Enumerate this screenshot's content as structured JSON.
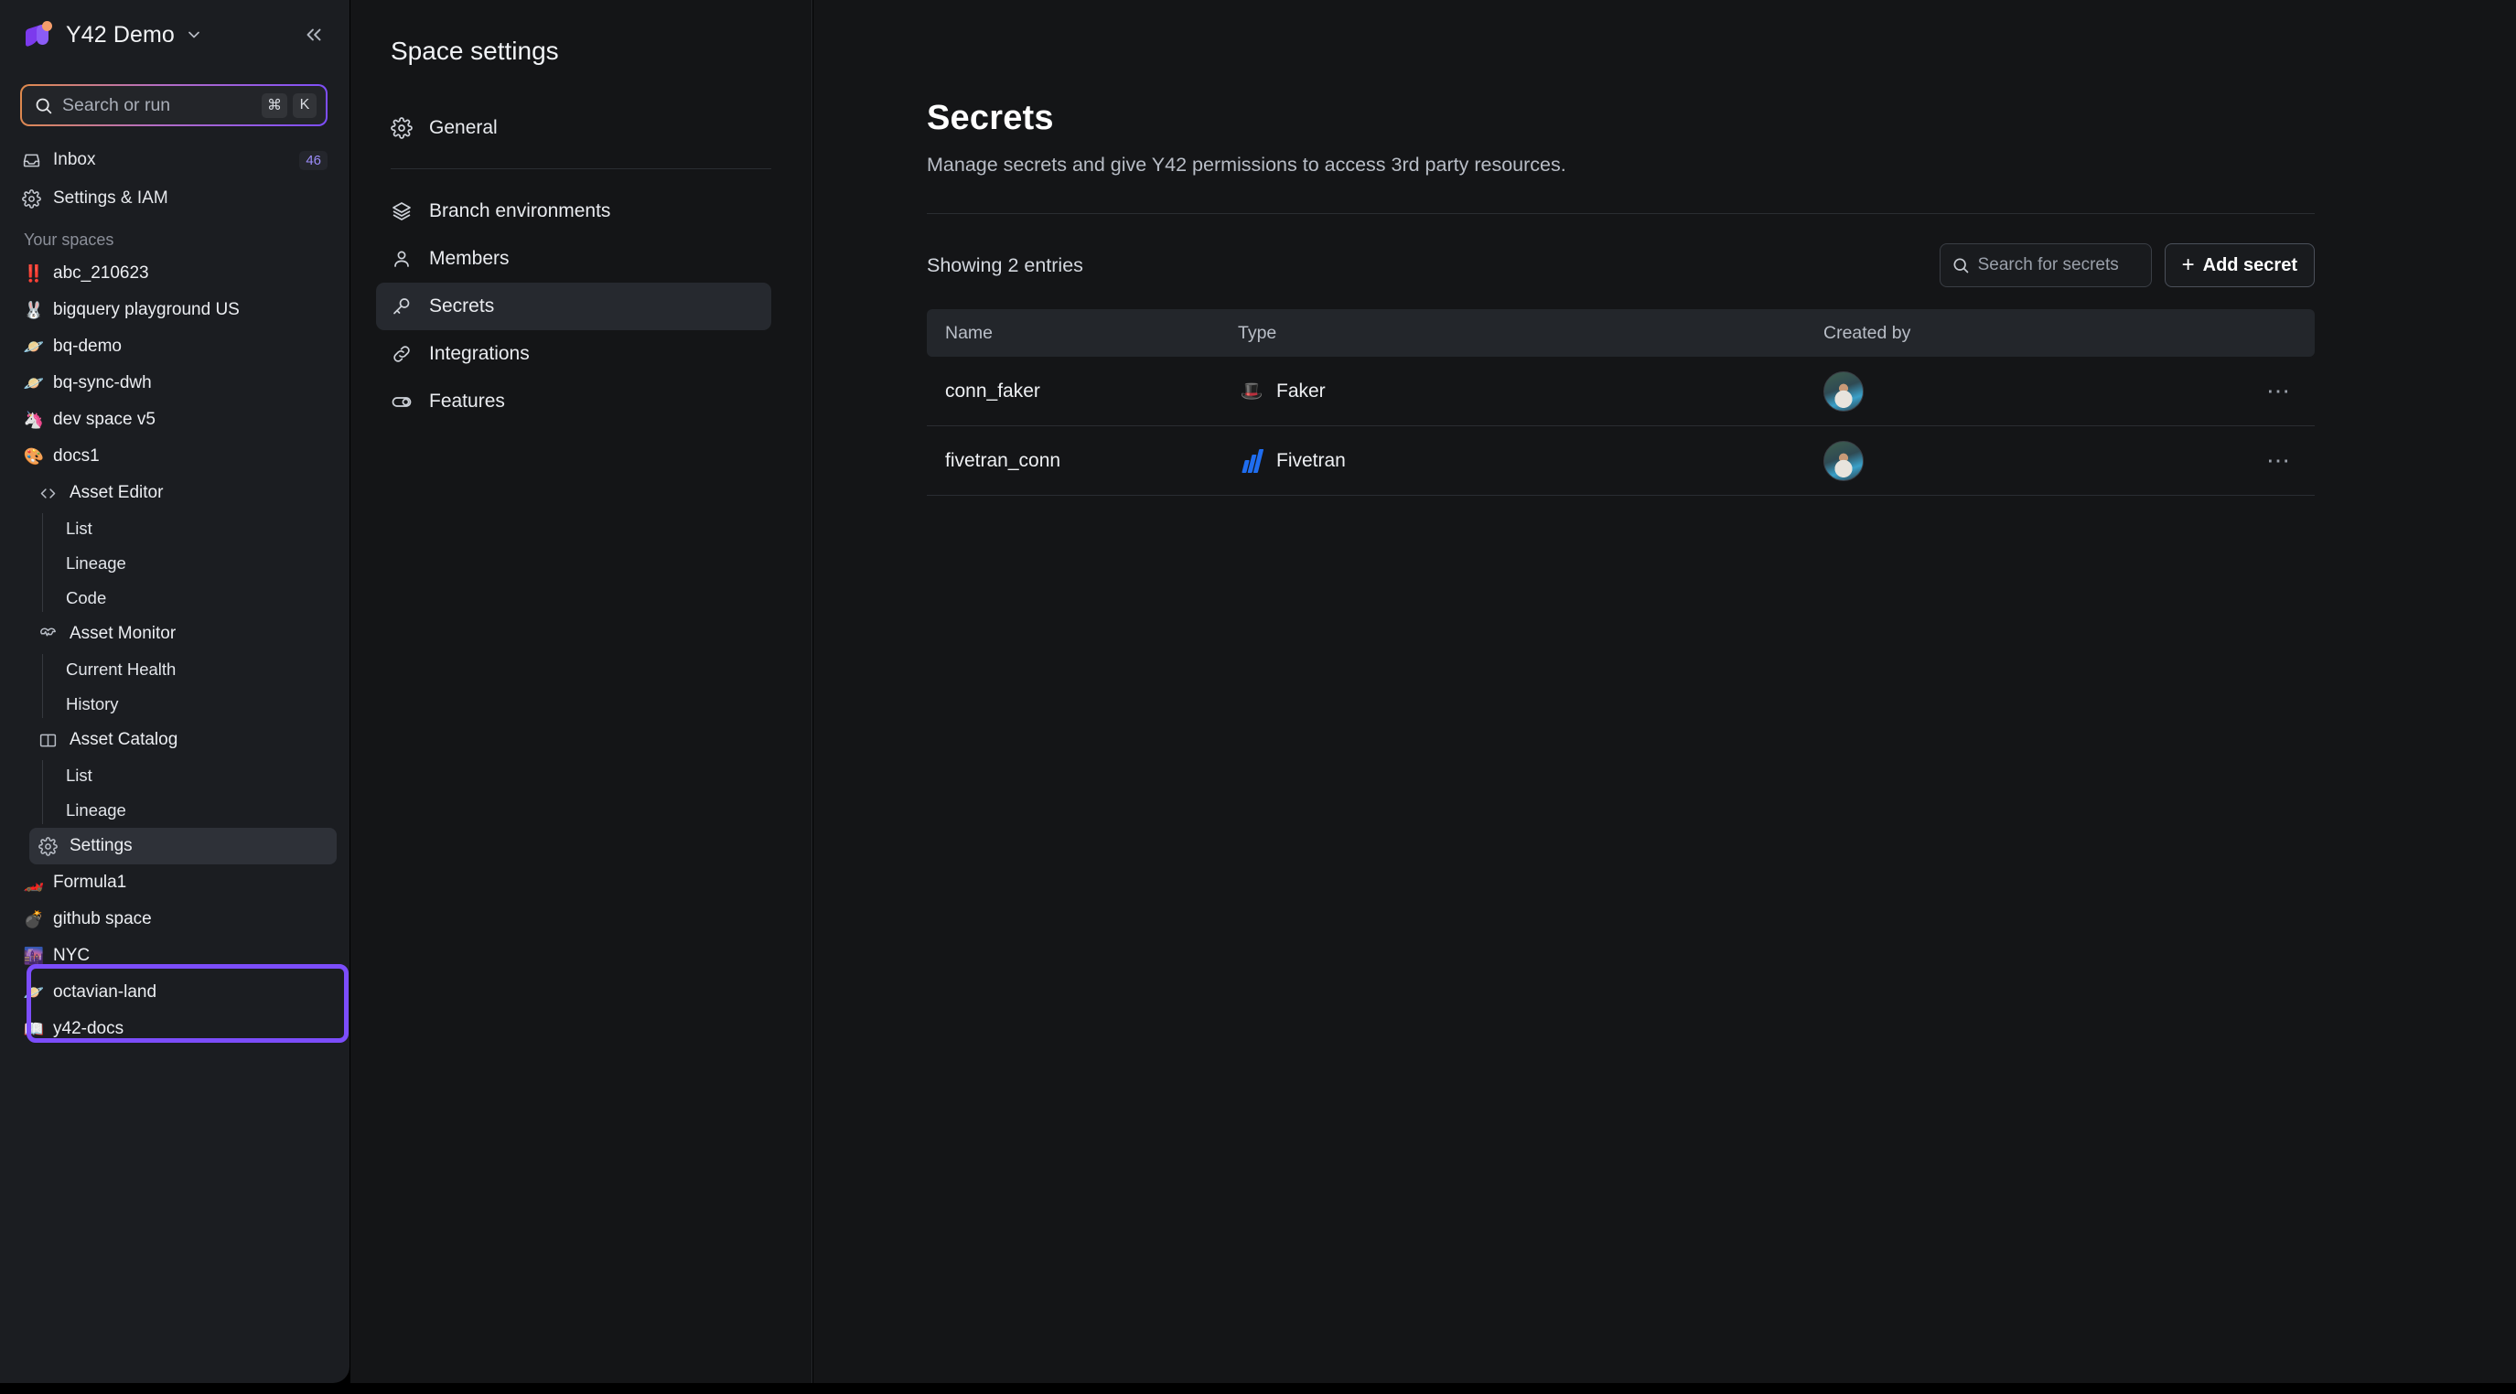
{
  "workspace": {
    "name": "Y42 Demo",
    "logo_icon": "y42-logo",
    "caret_icon": "chevron-down-icon",
    "collapse_icon": "collapse-sidebar-icon"
  },
  "search": {
    "placeholder": "Search or run",
    "icon": "search-icon",
    "shortcut_keys": [
      "⌘",
      "K"
    ]
  },
  "sidebar": {
    "nav": [
      {
        "label": "Inbox",
        "icon": "inbox-icon",
        "badge": "46"
      },
      {
        "label": "Settings & IAM",
        "icon": "gear-icon",
        "badge": ""
      }
    ],
    "section_label": "Your spaces",
    "spaces": [
      {
        "label": "abc_210623",
        "emoji": "‼️"
      },
      {
        "label": "bigquery playground US",
        "emoji": "🐰"
      },
      {
        "label": "bq-demo",
        "emoji": "🪐"
      },
      {
        "label": "bq-sync-dwh",
        "emoji": "🪐"
      },
      {
        "label": "dev space v5",
        "emoji": "🦄"
      },
      {
        "label": "docs1",
        "emoji": "🎨"
      }
    ],
    "docs1_tree": [
      {
        "label": "Asset Editor",
        "icon": "code-icon",
        "children": [
          "List",
          "Lineage",
          "Code"
        ]
      },
      {
        "label": "Asset Monitor",
        "icon": "heart-pulse-icon",
        "children": [
          "Current Health",
          "History"
        ]
      },
      {
        "label": "Asset Catalog",
        "icon": "book-icon",
        "children": [
          "List",
          "Lineage"
        ]
      }
    ],
    "settings_item": {
      "label": "Settings",
      "icon": "gear-icon"
    },
    "spaces_after": [
      {
        "label": "Formula1",
        "emoji": "🏎️"
      },
      {
        "label": "github space",
        "emoji": "💣"
      },
      {
        "label": "NYC",
        "emoji": "🌆"
      },
      {
        "label": "octavian-land",
        "emoji": "🪐"
      },
      {
        "label": "y42-docs",
        "emoji": "📖"
      }
    ],
    "highlight_color": "#7c4dfb"
  },
  "space_settings": {
    "title": "Space settings",
    "items": [
      {
        "label": "General",
        "icon": "gear-icon",
        "active": false
      },
      {
        "label": "Branch environments",
        "icon": "layers-icon",
        "active": false
      },
      {
        "label": "Members",
        "icon": "user-icon",
        "active": false
      },
      {
        "label": "Secrets",
        "icon": "key-icon",
        "active": true
      },
      {
        "label": "Integrations",
        "icon": "link-icon",
        "active": false
      },
      {
        "label": "Features",
        "icon": "toggle-icon",
        "active": false
      }
    ]
  },
  "main": {
    "title": "Secrets",
    "subtitle": "Manage secrets and give Y42 permissions to access 3rd party resources.",
    "entries_label": "Showing 2 entries",
    "search_placeholder": "Search for secrets",
    "search_icon": "search-icon",
    "add_button": {
      "plus": "+",
      "label": "Add secret"
    },
    "table": {
      "columns": [
        "Name",
        "Type",
        "Created by",
        ""
      ],
      "rows": [
        {
          "name": "conn_faker",
          "type": "Faker",
          "type_icon": "faker-magic-icon",
          "created_by_avatar": "user-avatar",
          "actions_icon": "more-options-icon"
        },
        {
          "name": "fivetran_conn",
          "type": "Fivetran",
          "type_icon": "fivetran-logo-icon",
          "created_by_avatar": "user-avatar",
          "actions_icon": "more-options-icon"
        }
      ]
    }
  },
  "colors": {
    "accent_purple": "#7c4dfb",
    "accent_orange": "#e08a4b",
    "fivetran_blue": "#1f6df0",
    "sidebar_bg": "#1b1d21",
    "panel_bg": "#141517"
  }
}
